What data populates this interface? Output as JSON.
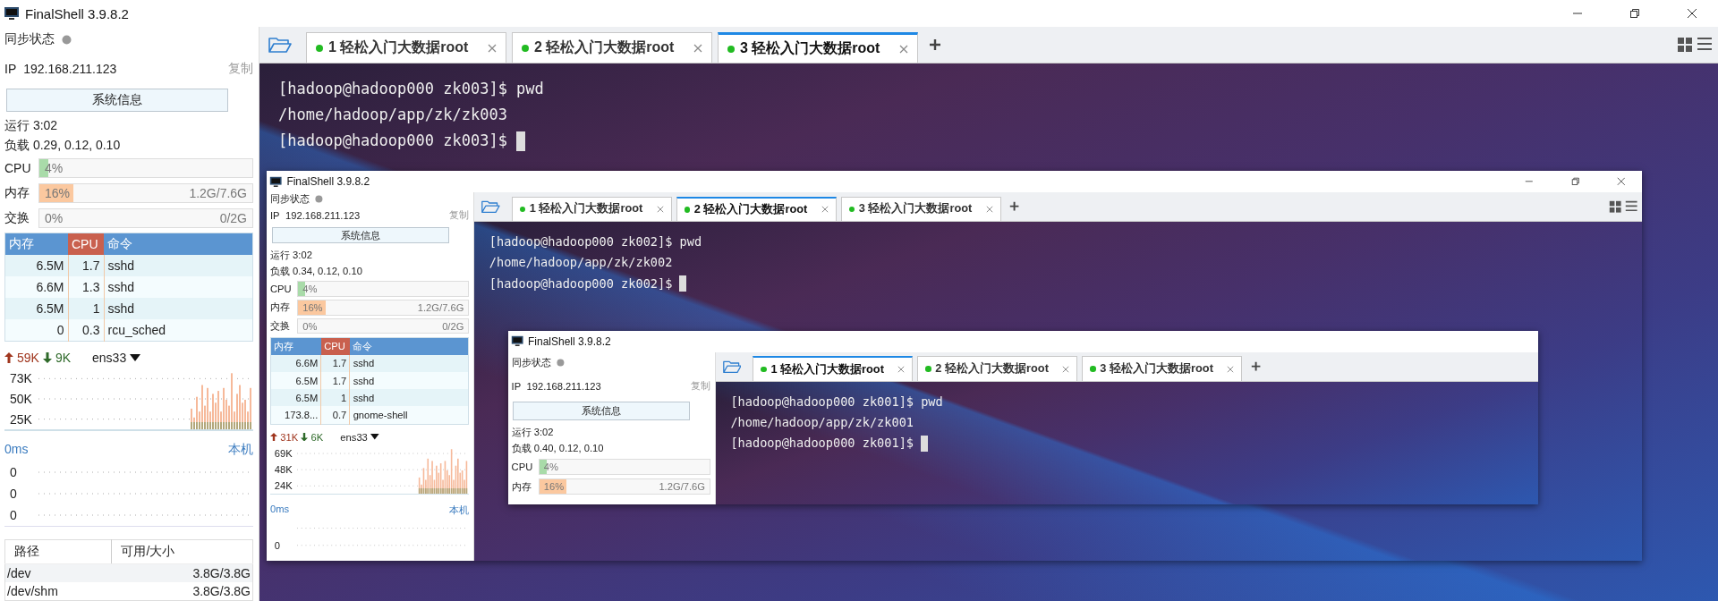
{
  "window": {
    "title": "FinalShell 3.9.8.2",
    "window_controls": true,
    "layout_icons": true,
    "sidebar": {
      "sync_label": "同步状态",
      "ip_label": "IP",
      "ip": "192.168.211.123",
      "copy": "复制",
      "sysinfo_button": "系统信息",
      "uptime": "运行 3:02",
      "load": "负载 0.29, 0.12, 0.10",
      "meters": [
        {
          "kind": "cpu",
          "label": "CPU",
          "percent": "4%",
          "level": 0.04
        },
        {
          "kind": "memory",
          "label": "内存",
          "percent": "16%",
          "level": 0.16,
          "detail": "1.2G/7.6G"
        },
        {
          "kind": "swap",
          "label": "交换",
          "percent": "0%",
          "level": 0,
          "detail": "0/2G"
        }
      ],
      "processes": {
        "columns": [
          "内存",
          "CPU",
          "命令"
        ],
        "rows": [
          [
            "6.5M",
            "1.7",
            "sshd"
          ],
          [
            "6.6M",
            "1.3",
            "sshd"
          ],
          [
            "6.5M",
            "1",
            "sshd"
          ],
          [
            "0",
            "0.3",
            "rcu_sched"
          ]
        ]
      },
      "network": {
        "upload": "59K",
        "download": "9K",
        "interface": "ens33",
        "y_labels": [
          "73K",
          "50K",
          "25K"
        ]
      },
      "ping": {
        "latency": "0ms",
        "host": "本机",
        "y_labels": [
          "0",
          "0",
          "0"
        ]
      },
      "disks": {
        "columns": [
          "路径",
          "可用/大小"
        ],
        "rows": [
          [
            "/dev",
            "3.8G/3.8G"
          ],
          [
            "/dev/shm",
            "3.8G/3.8G"
          ]
        ]
      }
    },
    "tabs": [
      {
        "label": "1 轻松入门大数据root",
        "selected": false
      },
      {
        "label": "2 轻松入门大数据root",
        "selected": false
      },
      {
        "label": "3 轻松入门大数据root",
        "selected": true
      }
    ],
    "terminal": {
      "lines": [
        "[hadoop@hadoop000 zk003]$ pwd",
        "/home/hadoop/app/zk/zk003",
        "[hadoop@hadoop000 zk003]$"
      ],
      "cursor": true,
      "embedded_window": {
        "title": "FinalShell 3.9.8.2",
        "window_controls": true,
        "layout_icons": true,
        "sidebar": {
          "sync_label": "同步状态",
          "ip_label": "IP",
          "ip": "192.168.211.123",
          "copy": "复制",
          "sysinfo_button": "系统信息",
          "uptime": "运行 3:02",
          "load": "负载 0.34, 0.12, 0.10",
          "meters": [
            {
              "kind": "cpu",
              "label": "CPU",
              "percent": "4%",
              "level": 0.04
            },
            {
              "kind": "memory",
              "label": "内存",
              "percent": "16%",
              "level": 0.16,
              "detail": "1.2G/7.6G"
            },
            {
              "kind": "swap",
              "label": "交换",
              "percent": "0%",
              "level": 0,
              "detail": "0/2G"
            }
          ],
          "processes": {
            "columns": [
              "内存",
              "CPU",
              "命令"
            ],
            "rows": [
              [
                "6.6M",
                "1.7",
                "sshd"
              ],
              [
                "6.5M",
                "1.7",
                "sshd"
              ],
              [
                "6.5M",
                "1",
                "sshd"
              ],
              [
                "173.8...",
                "0.7",
                "gnome-shell"
              ]
            ]
          },
          "network": {
            "upload": "31K",
            "download": "6K",
            "interface": "ens33",
            "y_labels": [
              "69K",
              "48K",
              "24K"
            ]
          },
          "ping": {
            "latency": "0ms",
            "host": "本机",
            "y_labels": [
              "0"
            ]
          }
        },
        "tabs": [
          {
            "label": "1 轻松入门大数据root",
            "selected": false
          },
          {
            "label": "2 轻松入门大数据root",
            "selected": true
          },
          {
            "label": "3 轻松入门大数据root",
            "selected": false
          }
        ],
        "terminal": {
          "lines": [
            "[hadoop@hadoop000 zk002]$ pwd",
            "/home/hadoop/app/zk/zk002",
            "[hadoop@hadoop000 zk002]$"
          ],
          "cursor": true,
          "embedded_window": {
            "title": "FinalShell 3.9.8.2",
            "window_controls": false,
            "layout_icons": false,
            "sidebar": {
              "sync_label": "同步状态",
              "ip_label": "IP",
              "ip": "192.168.211.123",
              "copy": "复制",
              "sysinfo_button": "系统信息",
              "uptime": "运行 3:02",
              "load": "负载 0.40, 0.12, 0.10",
              "meters": [
                {
                  "kind": "cpu",
                  "label": "CPU",
                  "percent": "4%",
                  "level": 0.04
                },
                {
                  "kind": "memory",
                  "label": "内存",
                  "percent": "16%",
                  "level": 0.16,
                  "detail": "1.2G/7.6G"
                }
              ]
            },
            "tabs": [
              {
                "label": "1 轻松入门大数据root",
                "selected": true
              },
              {
                "label": "2 轻松入门大数据root",
                "selected": false
              },
              {
                "label": "3 轻松入门大数据root",
                "selected": false
              }
            ],
            "terminal": {
              "lines": [
                "[hadoop@hadoop000 zk001]$ pwd",
                "/home/hadoop/app/zk/zk001",
                "[hadoop@hadoop000 zk001]$"
              ],
              "cursor": true
            }
          }
        }
      }
    }
  }
}
